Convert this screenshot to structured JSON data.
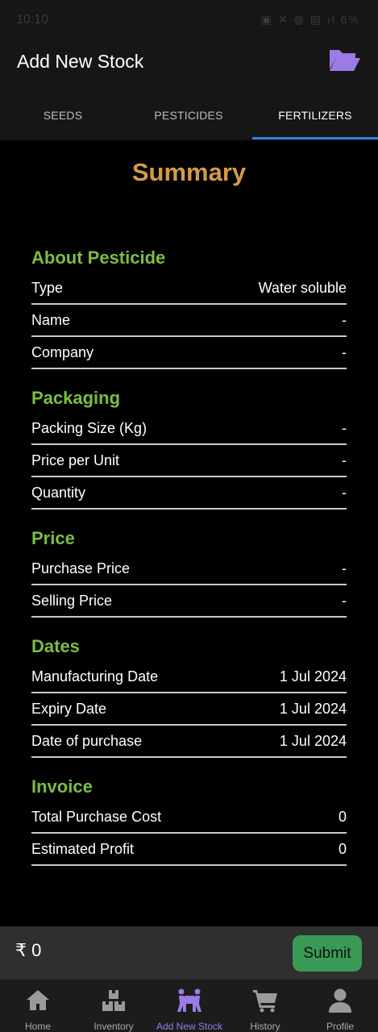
{
  "status_bar": {
    "time": "10:10",
    "icons": "▣ ✕ ◍ ▤ ıl 6%"
  },
  "app_bar": {
    "title": "Add New Stock",
    "folder_icon": "folder-open-icon",
    "folder_color": "#9d7be6"
  },
  "tabs": [
    {
      "label": "SEEDS",
      "active": false
    },
    {
      "label": "PESTICIDES",
      "active": false
    },
    {
      "label": "FERTILIZERS",
      "active": true
    }
  ],
  "summary_title": "Summary",
  "sections": {
    "about": {
      "title": "About Pesticide",
      "rows": [
        {
          "label": "Type",
          "value": "Water soluble"
        },
        {
          "label": "Name",
          "value": "-"
        },
        {
          "label": "Company",
          "value": "-"
        }
      ]
    },
    "packaging": {
      "title": "Packaging",
      "rows": [
        {
          "label": "Packing Size (Kg)",
          "value": "-"
        },
        {
          "label": "Price per Unit",
          "value": "-"
        },
        {
          "label": "Quantity",
          "value": "-"
        }
      ]
    },
    "price": {
      "title": "Price",
      "rows": [
        {
          "label": "Purchase Price",
          "value": "-"
        },
        {
          "label": "Selling Price",
          "value": "-"
        }
      ]
    },
    "dates": {
      "title": "Dates",
      "rows": [
        {
          "label": "Manufacturing Date",
          "value": "1 Jul 2024"
        },
        {
          "label": "Expiry Date",
          "value": "1 Jul 2024"
        },
        {
          "label": "Date of purchase",
          "value": "1 Jul 2024"
        }
      ]
    },
    "invoice": {
      "title": "Invoice",
      "rows": [
        {
          "label": "Total Purchase Cost",
          "value": "0"
        },
        {
          "label": "Estimated Profit",
          "value": "0"
        }
      ]
    }
  },
  "footer": {
    "total": "₹ 0",
    "submit_label": "Submit"
  },
  "bottom_nav": [
    {
      "label": "Home",
      "icon": "home-icon",
      "active": false
    },
    {
      "label": "Inventory",
      "icon": "boxes-icon",
      "active": false
    },
    {
      "label": "Add New Stock",
      "icon": "people-carry-icon",
      "active": true
    },
    {
      "label": "History",
      "icon": "cart-icon",
      "active": false
    },
    {
      "label": "Profile",
      "icon": "user-icon",
      "active": false
    }
  ],
  "colors": {
    "accent": "#9d7be6",
    "section_green": "#7cbd45",
    "title_orange": "#d59a48",
    "tab_indicator": "#2f84e6",
    "submit_green": "#3a9a55"
  }
}
